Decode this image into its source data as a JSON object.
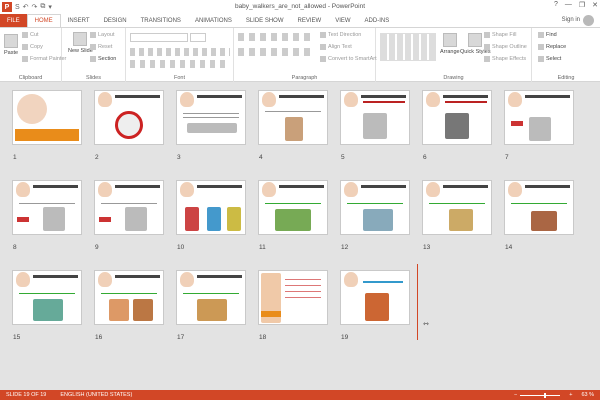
{
  "window": {
    "title": "baby_walkers_are_not_allowed - PowerPoint",
    "controls": [
      "?",
      "—",
      "❐",
      "✕"
    ]
  },
  "qat": [
    "S",
    "↶",
    "↷",
    "⧉",
    "▾"
  ],
  "tabs": [
    "FILE",
    "HOME",
    "INSERT",
    "DESIGN",
    "TRANSITIONS",
    "ANIMATIONS",
    "SLIDE SHOW",
    "REVIEW",
    "VIEW",
    "ADD-INS"
  ],
  "account": {
    "signin": "Sign in"
  },
  "ribbon": {
    "clipboard": {
      "label": "Clipboard",
      "paste": "Paste",
      "cut": "Cut",
      "copy": "Copy",
      "format_painter": "Format Painter"
    },
    "slides": {
      "label": "Slides",
      "new_slide": "New Slide",
      "layout": "Layout",
      "reset": "Reset",
      "section": "Section"
    },
    "font": {
      "label": "Font"
    },
    "paragraph": {
      "label": "Paragraph",
      "text_direction": "Text Direction",
      "align_text": "Align Text",
      "smartart": "Convert to SmartArt"
    },
    "drawing": {
      "label": "Drawing",
      "arrange": "Arrange",
      "quick_styles": "Quick Styles",
      "shape_fill": "Shape Fill",
      "shape_outline": "Shape Outline",
      "shape_effects": "Shape Effects"
    },
    "editing": {
      "label": "Editing",
      "find": "Find",
      "replace": "Replace",
      "select": "Select"
    }
  },
  "slides": [
    "1",
    "2",
    "3",
    "4",
    "5",
    "6",
    "7",
    "8",
    "9",
    "10",
    "11",
    "12",
    "13",
    "14",
    "15",
    "16",
    "17",
    "18",
    "19"
  ],
  "status": {
    "slide": "SLIDE 19 OF 19",
    "language": "ENGLISH (UNITED STATES)",
    "zoom": "63 %",
    "zoom_level": 0.63
  },
  "colors": {
    "accent": "#d24726",
    "slide_bg": "#e3e3e3"
  }
}
